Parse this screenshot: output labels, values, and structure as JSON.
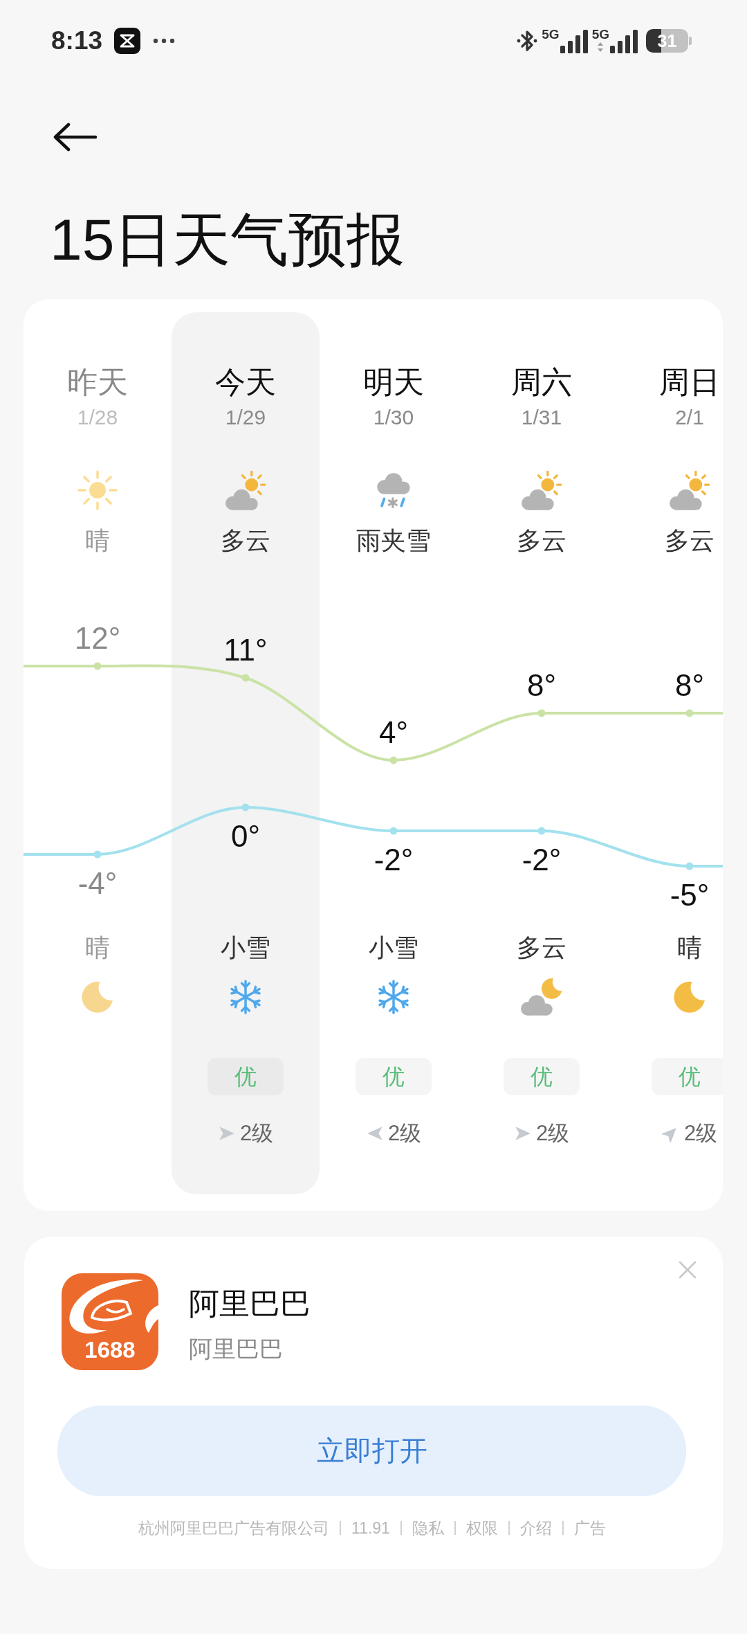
{
  "status_bar": {
    "time": "8:13",
    "sims": [
      {
        "label": "5G",
        "kind": "plain"
      },
      {
        "label": "5G",
        "kind": "data"
      }
    ],
    "battery": "31"
  },
  "header": {
    "title": "15日天气预报"
  },
  "forecast": {
    "days": [
      {
        "day": "昨天",
        "date": "1/28",
        "day_weather": {
          "kind": "sun",
          "text": "晴"
        },
        "night_weather": {
          "text": "晴",
          "kind": "moon"
        },
        "past": true,
        "selected": false
      },
      {
        "day": "今天",
        "date": "1/29",
        "day_weather": {
          "kind": "partly-cloudy",
          "text": "多云"
        },
        "night_weather": {
          "text": "小雪",
          "kind": "snow"
        },
        "aqi": "优",
        "wind": {
          "kind": "right",
          "text": "2级"
        },
        "past": false,
        "selected": true
      },
      {
        "day": "明天",
        "date": "1/30",
        "day_weather": {
          "kind": "sleet",
          "text": "雨夹雪"
        },
        "night_weather": {
          "text": "小雪",
          "kind": "snow"
        },
        "aqi": "优",
        "wind": {
          "kind": "left",
          "text": "2级"
        },
        "past": false,
        "selected": false
      },
      {
        "day": "周六",
        "date": "1/31",
        "day_weather": {
          "kind": "partly-cloudy",
          "text": "多云"
        },
        "night_weather": {
          "text": "多云",
          "kind": "partly-cloudy-night"
        },
        "aqi": "优",
        "wind": {
          "kind": "right",
          "text": "2级"
        },
        "past": false,
        "selected": false
      },
      {
        "day": "周日",
        "date": "2/1",
        "day_weather": {
          "kind": "partly-cloudy",
          "text": "多云"
        },
        "night_weather": {
          "text": "晴",
          "kind": "moon"
        },
        "aqi": "优",
        "wind": {
          "kind": "up-right",
          "text": "2级"
        },
        "past": false,
        "selected": false
      }
    ],
    "chart_data": {
      "type": "line",
      "data_labels": true,
      "series": [
        {
          "color": "#cbe2a6",
          "marker": "circle",
          "values": [
            12,
            11,
            4,
            8,
            8
          ],
          "value_labels": [
            "12°",
            "11°",
            "4°",
            "8°",
            "8°"
          ]
        },
        {
          "color": "#a3e1ee",
          "marker": "circle",
          "values": [
            -4,
            0,
            -2,
            -2,
            -5
          ],
          "value_labels": [
            "-4°",
            "0°",
            "-2°",
            "-2°",
            "-5°"
          ]
        }
      ]
    }
  },
  "ad": {
    "logo_text": "1688",
    "app_name": "阿里巴巴",
    "app_subtitle": "阿里巴巴",
    "button": "立即打开",
    "advertiser": "杭州阿里巴巴广告有限公司",
    "version": "11.91",
    "links": [
      "隐私",
      "权限",
      "介绍",
      "广告"
    ]
  }
}
